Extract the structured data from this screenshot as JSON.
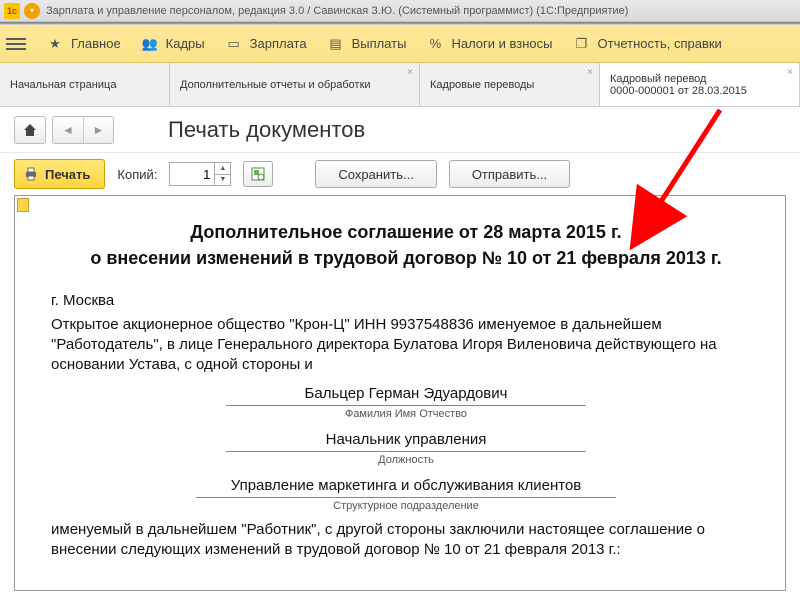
{
  "titlebar": {
    "text": "Зарплата и управление персоналом, редакция 3.0 / Савинская З.Ю. (Системный программист)  (1С:Предприятие)"
  },
  "menubar": {
    "main": "Главное",
    "kadry": "Кадры",
    "zarplata": "Зарплата",
    "vyplaty": "Выплаты",
    "nalogi": "Налоги и взносы",
    "otchet": "Отчетность, справки"
  },
  "tabs": {
    "t0": "Начальная страница",
    "t1": "Дополнительные отчеты и обработки",
    "t2": "Кадровые переводы",
    "t3a": "Кадровый перевод",
    "t3b": "0000-000001 от 28.03.2015"
  },
  "page": {
    "title": "Печать документов"
  },
  "toolbar": {
    "print": "Печать",
    "copies_label": "Копий:",
    "copies_value": "1",
    "save": "Сохранить...",
    "send": "Отправить..."
  },
  "doc": {
    "title1": "Дополнительное соглашение от 28 марта 2015 г.",
    "title2": "о внесении изменений в трудовой договор № 10 от 21 февраля 2013 г.",
    "city": "г. Москва",
    "p1": "Открытое акционерное общество \"Крон-Ц\" ИНН 9937548836 именуемое в дальнейшем \"Работодатель\", в лице Генерального директора Булатова Игоря Виленовича действующего на основании Устава, с одной стороны и",
    "fio": "Бальцер Герман Эдуардович",
    "fio_label": "Фамилия Имя Отчество",
    "pos": "Начальник управления",
    "pos_label": "Должность",
    "dep": "Управление маркетинга и обслуживания клиентов",
    "dep_label": "Структурное подразделение",
    "p2": "именуемый в дальнейшем \"Работник\", с другой стороны заключили настоящее соглашение о внесении следующих изменений в трудовой договор № 10 от 21 февраля 2013 г.:"
  }
}
